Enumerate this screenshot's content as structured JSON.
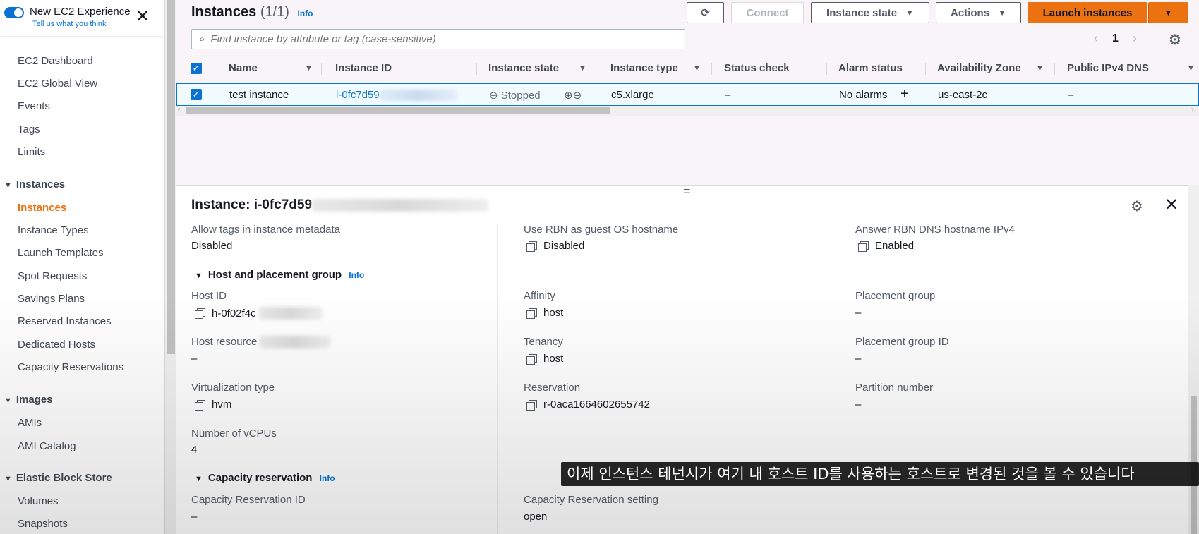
{
  "sidebar": {
    "experience_title": "New EC2 Experience",
    "experience_link": "Tell us what you think",
    "items": [
      {
        "label": "EC2 Dashboard"
      },
      {
        "label": "EC2 Global View"
      },
      {
        "label": "Events"
      },
      {
        "label": "Tags"
      },
      {
        "label": "Limits"
      }
    ],
    "sections": [
      {
        "title": "Instances",
        "items": [
          "Instances",
          "Instance Types",
          "Launch Templates",
          "Spot Requests",
          "Savings Plans",
          "Reserved Instances",
          "Dedicated Hosts",
          "Capacity Reservations"
        ]
      },
      {
        "title": "Images",
        "items": [
          "AMIs",
          "AMI Catalog"
        ]
      },
      {
        "title": "Elastic Block Store",
        "items": [
          "Volumes",
          "Snapshots"
        ]
      }
    ]
  },
  "header": {
    "title": "Instances",
    "count": "(1/1)",
    "info": "Info",
    "buttons": {
      "connect": "Connect",
      "instance_state": "Instance state",
      "actions": "Actions",
      "launch": "Launch instances"
    }
  },
  "search": {
    "placeholder": "Find instance by attribute or tag (case-sensitive)"
  },
  "pager": {
    "page": "1"
  },
  "table": {
    "columns": [
      "Name",
      "Instance ID",
      "Instance state",
      "Instance type",
      "Status check",
      "Alarm status",
      "Availability Zone",
      "Public IPv4 DNS"
    ],
    "row": {
      "name": "test instance",
      "instance_id": "i-0fc7d59",
      "state": "Stopped",
      "type": "c5.xlarge",
      "status_check": "–",
      "alarm": "No alarms",
      "az": "us-east-2c",
      "dns": "–"
    }
  },
  "detail": {
    "title": "Instance: i-0fc7d59",
    "top_row": [
      {
        "label": "Allow tags in instance metadata",
        "value": "Disabled"
      },
      {
        "label": "Use RBN as guest OS hostname",
        "value": "Disabled"
      },
      {
        "label": "Answer RBN DNS hostname IPv4",
        "value": "Enabled"
      }
    ],
    "host_section": {
      "title": "Host and placement group",
      "info": "Info",
      "host_id_label": "Host ID",
      "host_id_value": "h-0f02f4c",
      "affinity_label": "Affinity",
      "affinity_value": "host",
      "placement_group_label": "Placement group",
      "placement_group_value": "–",
      "host_resource_label": "Host resource",
      "host_resource_value": "–",
      "tenancy_label": "Tenancy",
      "tenancy_value": "host",
      "placement_group_id_label": "Placement group ID",
      "placement_group_id_value": "–",
      "virt_label": "Virtualization type",
      "virt_value": "hvm",
      "reservation_label": "Reservation",
      "reservation_value": "r-0aca1664602655742",
      "partition_label": "Partition number",
      "partition_value": "–",
      "vcpu_label": "Number of vCPUs",
      "vcpu_value": "4"
    },
    "capacity_section": {
      "title": "Capacity reservation",
      "info": "Info",
      "id_label": "Capacity Reservation ID",
      "id_value": "–",
      "setting_label": "Capacity Reservation setting",
      "setting_value": "open"
    }
  },
  "subtitle": "이제 인스턴스 테넌시가 여기 내 호스트 ID를 사용하는 호스트로 변경된 것을 볼 수 있습니다"
}
